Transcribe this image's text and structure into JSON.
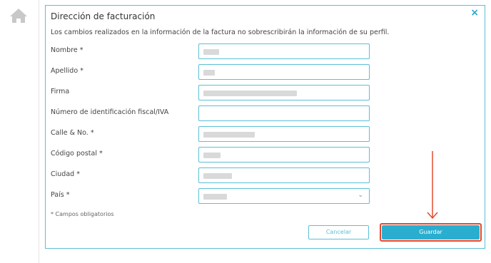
{
  "nav": {
    "home_icon": "home-icon"
  },
  "dialog": {
    "title": "Dirección de facturación",
    "close_glyph": "×",
    "subtitle": "Los cambios realizados en la información de la factura no sobrescribirán la información de su perfil.",
    "fields": [
      {
        "label": "Nombre *",
        "value": ""
      },
      {
        "label": "Apellido *",
        "value": ""
      },
      {
        "label": "Firma",
        "value": ""
      },
      {
        "label": "Número de identificación fiscal/IVA",
        "value": ""
      },
      {
        "label": "Calle & No. *",
        "value": ""
      },
      {
        "label": "Código postal *",
        "value": ""
      },
      {
        "label": "Ciudad *",
        "value": ""
      },
      {
        "label": "País *",
        "value": ""
      }
    ],
    "required_note": "* Campos obligatorios",
    "cancel_label": "Cancelar",
    "save_label": "Guardar"
  },
  "colors": {
    "accent": "#2aaed0",
    "border": "#5bbfd6",
    "highlight": "#e24a2e"
  }
}
